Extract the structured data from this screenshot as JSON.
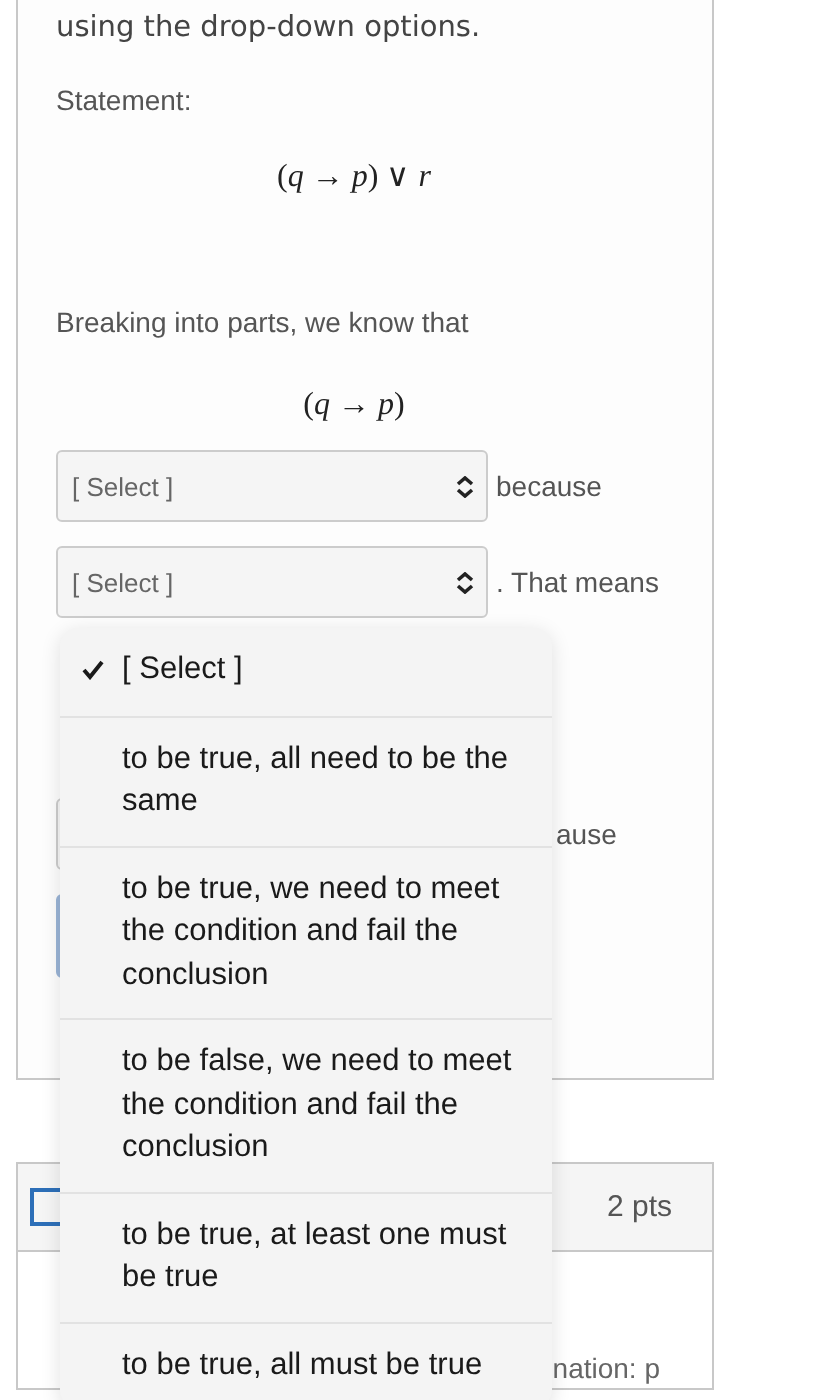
{
  "intro": "using the drop-down options.",
  "statement_label": "Statement:",
  "statement_formula": "(*q* → *p*) ∨ *r*",
  "breakdown_text": "Breaking into parts, we know that",
  "breakdown_formula": "(*q* → *p*)",
  "rows": [
    {
      "select": "[ Select ]",
      "suffix": "because"
    },
    {
      "select": "[ Select ]",
      "suffix": ". That means"
    }
  ],
  "hidden_suffix": "ause",
  "next_question": {
    "points": "2 pts",
    "partial_text": "nation: p"
  },
  "dropdown": {
    "options": [
      {
        "label": "[ Select ]",
        "selected": true
      },
      {
        "label": "to be true, all need to be the same",
        "selected": false
      },
      {
        "label": "to be true, we need to meet the condition and fail the conclusion",
        "selected": false
      },
      {
        "label": "to be false, we need to meet the condition and fail the conclusion",
        "selected": false
      },
      {
        "label": "to be true, at least one must be true",
        "selected": false
      },
      {
        "label": "to be true, all must be true",
        "selected": false
      }
    ]
  }
}
